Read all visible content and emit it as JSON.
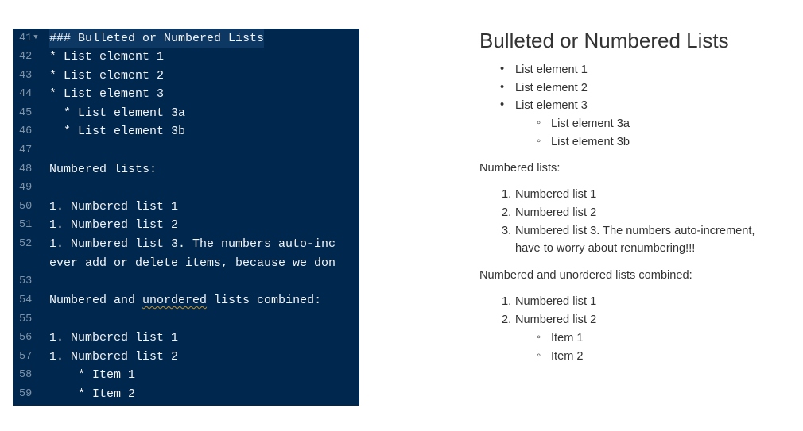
{
  "editor": {
    "lines": [
      {
        "num": "41",
        "text": "### Bulleted or Numbered Lists",
        "fold": "▼",
        "active": true
      },
      {
        "num": "42",
        "text": "* List element 1"
      },
      {
        "num": "43",
        "text": "* List element 2"
      },
      {
        "num": "44",
        "text": "* List element 3"
      },
      {
        "num": "45",
        "text": "  * List element 3a"
      },
      {
        "num": "46",
        "text": "  * List element 3b"
      },
      {
        "num": "47",
        "text": ""
      },
      {
        "num": "48",
        "text": "Numbered lists:"
      },
      {
        "num": "49",
        "text": ""
      },
      {
        "num": "50",
        "text": "1. Numbered list 1"
      },
      {
        "num": "51",
        "text": "1. Numbered list 2"
      },
      {
        "num": "52",
        "text": "1. Numbered list 3. The numbers auto-inc"
      },
      {
        "num": "",
        "text": "ever add or delete items, because we don"
      },
      {
        "num": "53",
        "text": ""
      },
      {
        "num": "54",
        "text_before": "Numbered and ",
        "text_squiggle": "unordered",
        "text_after": " lists combined:"
      },
      {
        "num": "55",
        "text": ""
      },
      {
        "num": "56",
        "text": "1. Numbered list 1"
      },
      {
        "num": "57",
        "text": "1. Numbered list 2"
      },
      {
        "num": "58",
        "text": "    * Item 1"
      },
      {
        "num": "59",
        "text": "    * Item 2"
      }
    ]
  },
  "preview": {
    "heading": "Bulleted or Numbered Lists",
    "bullets": [
      "List element 1",
      "List element 2",
      "List element 3"
    ],
    "sub_bullets": [
      "List element 3a",
      "List element 3b"
    ],
    "numbered_label": "Numbered lists:",
    "numbered": [
      "Numbered list 1",
      "Numbered list 2",
      "Numbered list 3. The numbers auto-increment,"
    ],
    "numbered_wrap": "have to worry about renumbering!!!",
    "combined_label": "Numbered and unordered lists combined:",
    "combined": [
      "Numbered list 1",
      "Numbered list 2"
    ],
    "combined_items": [
      "Item 1",
      "Item 2"
    ],
    "markers": {
      "disc": "•",
      "circle": "◦",
      "n1": "1.",
      "n2": "2.",
      "n3": "3."
    }
  }
}
